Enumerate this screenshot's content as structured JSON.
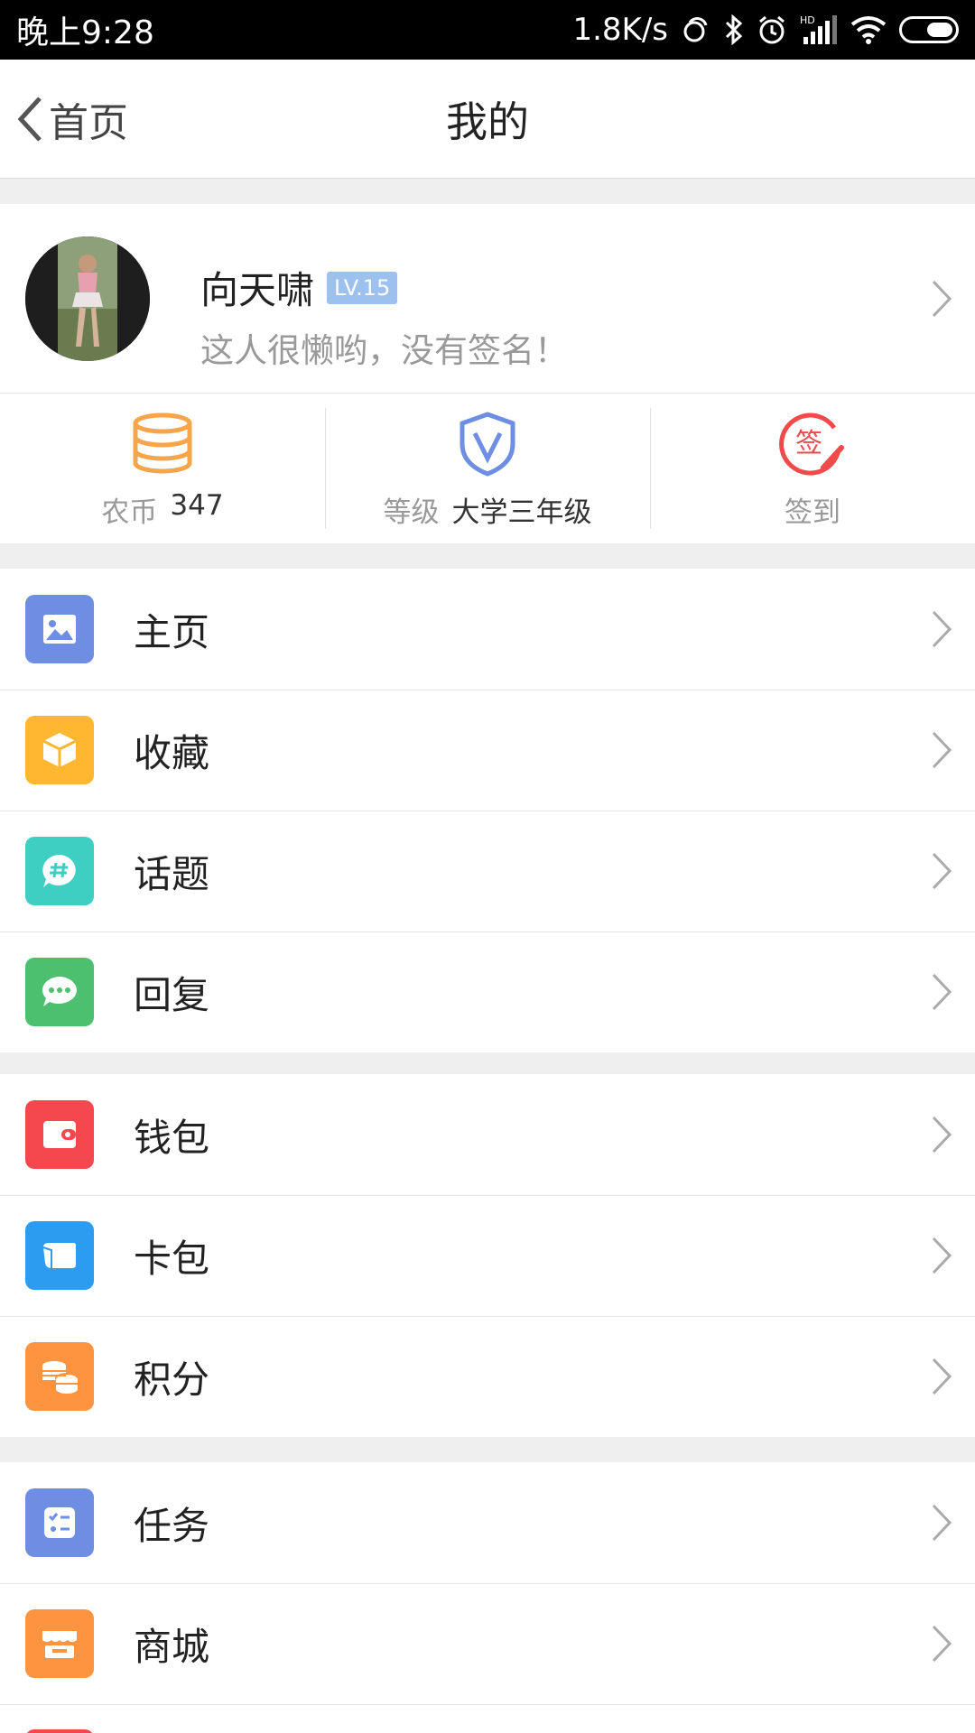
{
  "status_bar": {
    "time": "晚上9:28",
    "speed": "1.8K/s",
    "network_label": "HD"
  },
  "header": {
    "back_label": "首页",
    "title": "我的"
  },
  "profile": {
    "name": "向天啸",
    "level_badge": "LV.15",
    "signature": "这人很懒哟，没有签名！"
  },
  "stats": {
    "coins_label": "农币",
    "coins_value": "347",
    "grade_label": "等级",
    "grade_value": "大学三年级",
    "checkin_label": "签到",
    "checkin_icon_char": "签"
  },
  "menu_groups": [
    [
      {
        "label": "主页",
        "icon": "image-icon",
        "color": "#6d8ee2"
      },
      {
        "label": "收藏",
        "icon": "box-icon",
        "color": "#ffb731"
      },
      {
        "label": "话题",
        "icon": "hashtag-chat-icon",
        "color": "#3fcfc2"
      },
      {
        "label": "回复",
        "icon": "reply-chat-icon",
        "color": "#4cc06e"
      }
    ],
    [
      {
        "label": "钱包",
        "icon": "wallet-icon",
        "color": "#f5474e"
      },
      {
        "label": "卡包",
        "icon": "card-icon",
        "color": "#2c9cf0"
      },
      {
        "label": "积分",
        "icon": "coins-icon",
        "color": "#ff9440"
      }
    ],
    [
      {
        "label": "任务",
        "icon": "task-list-icon",
        "color": "#6d8ee2"
      },
      {
        "label": "商城",
        "icon": "shop-icon",
        "color": "#ff9440"
      }
    ]
  ],
  "colors": {
    "accent_blue": "#6d8ee2",
    "coin_orange": "#f7a54a",
    "checkin_red": "#f04a4a"
  }
}
